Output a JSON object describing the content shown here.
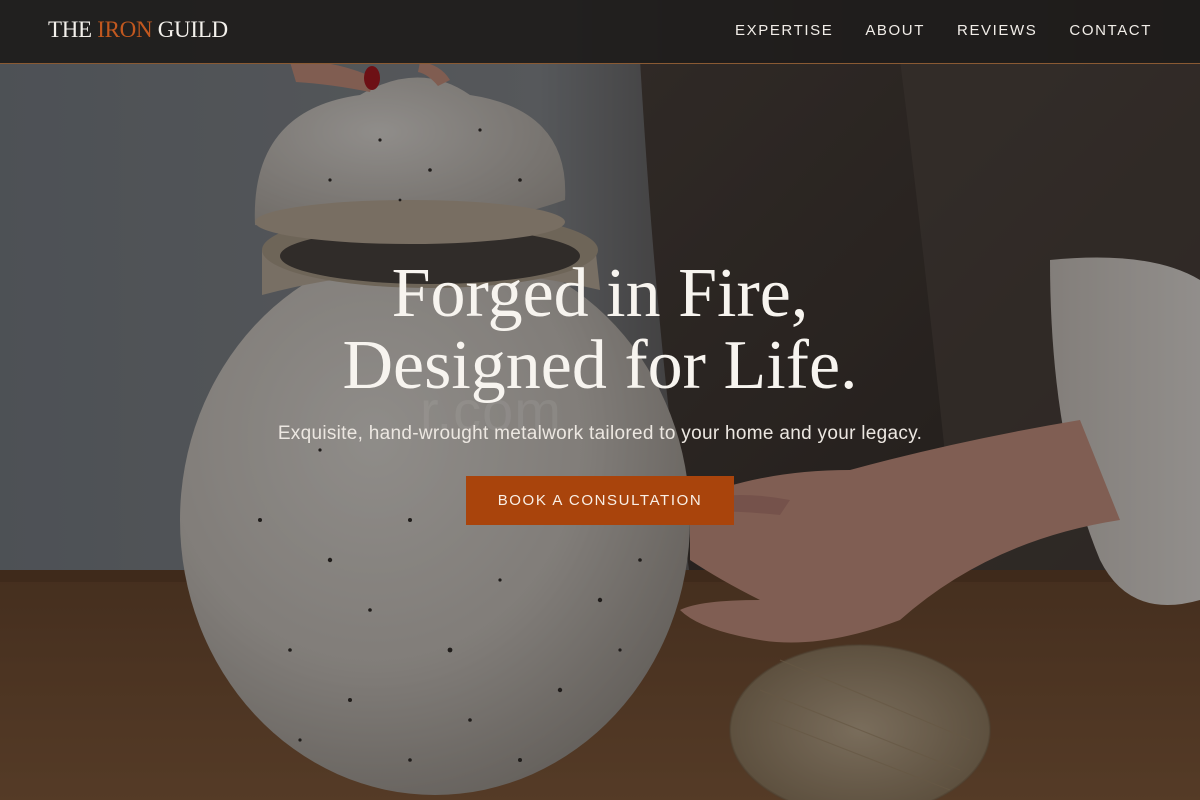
{
  "brand": {
    "prefix": "THE",
    "accent": "IRON",
    "suffix": "GUILD",
    "accent_color": "#c2581f"
  },
  "nav": {
    "items": [
      {
        "label": "EXPERTISE"
      },
      {
        "label": "ABOUT"
      },
      {
        "label": "REVIEWS"
      },
      {
        "label": "CONTACT"
      }
    ]
  },
  "hero": {
    "title_line1": "Forged in Fire,",
    "title_line2": "Designed for Life.",
    "subtitle": "Exquisite, hand-wrought metalwork tailored to your home and your legacy.",
    "cta_label": "BOOK A CONSULTATION",
    "cta_color": "#a9440c",
    "watermark": "r.com",
    "background_image": "photo-ceramic-jar-hands"
  }
}
